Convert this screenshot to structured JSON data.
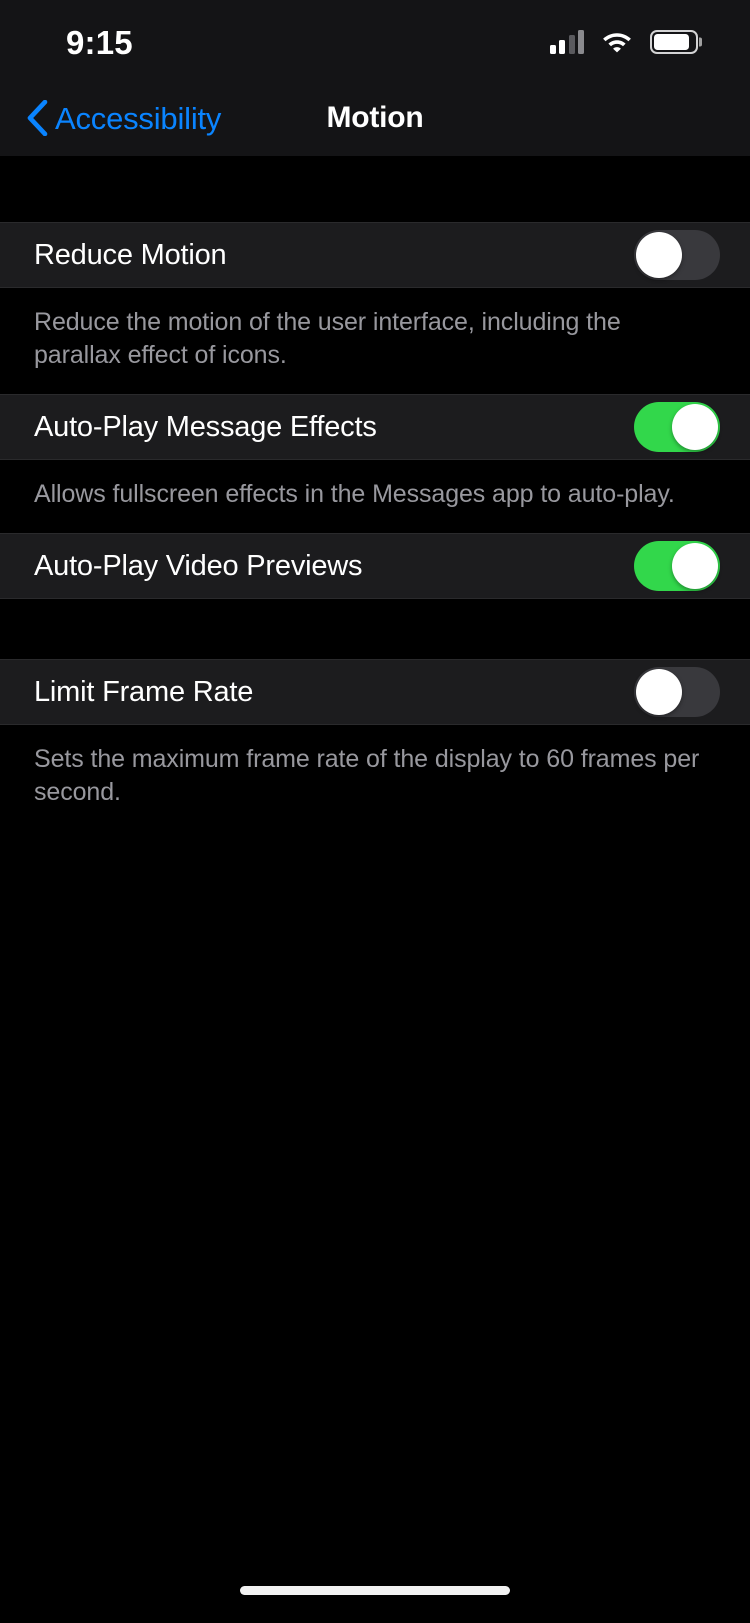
{
  "status_bar": {
    "time": "9:15",
    "cellular_icon": "cellular-signal-icon",
    "cellular_bars_filled": 2,
    "cellular_bars_total": 4,
    "wifi_icon": "wifi-icon",
    "battery_icon": "battery-icon",
    "battery_level_percent": 88
  },
  "nav_bar": {
    "back_label": "Accessibility",
    "back_icon": "chevron-left-icon",
    "title": "Motion",
    "accent_color": "#0A84FF"
  },
  "colors": {
    "background": "#000000",
    "cell_background": "#1C1C1E",
    "label": "#FFFFFF",
    "footer_text": "#98989E",
    "switch_on": "#32D74B",
    "switch_off": "#39393D",
    "separator": "#2A2A2C"
  },
  "sections": [
    {
      "rows": [
        {
          "label": "Reduce Motion",
          "switch_state": "off",
          "switch_on": false
        }
      ],
      "footer": "Reduce the motion of the user interface, including the parallax effect of icons."
    },
    {
      "rows": [
        {
          "label": "Auto-Play Message Effects",
          "switch_state": "on",
          "switch_on": true
        }
      ],
      "footer": "Allows fullscreen effects in the Messages app to auto-play."
    },
    {
      "rows": [
        {
          "label": "Auto-Play Video Previews",
          "switch_state": "on",
          "switch_on": true
        }
      ],
      "footer": ""
    },
    {
      "rows": [
        {
          "label": "Limit Frame Rate",
          "switch_state": "off",
          "switch_on": false
        }
      ],
      "footer": "Sets the maximum frame rate of the display to 60 frames per second."
    }
  ],
  "home_indicator": "home-indicator"
}
